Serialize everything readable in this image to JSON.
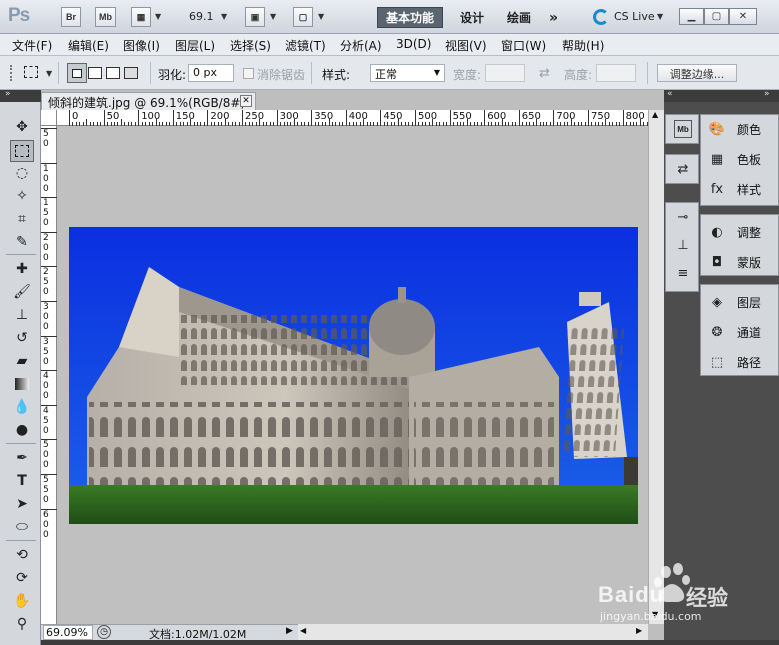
{
  "titlebar": {
    "logo": "Ps",
    "br_label": "Br",
    "mb_label": "Mb",
    "zoom_value": "69.1",
    "workspaces": [
      "基本功能",
      "设计",
      "绘画"
    ],
    "more": "»",
    "cs_live": "CS Live"
  },
  "menu": [
    "文件(F)",
    "编辑(E)",
    "图像(I)",
    "图层(L)",
    "选择(S)",
    "滤镜(T)",
    "分析(A)",
    "3D(D)",
    "视图(V)",
    "窗口(W)",
    "帮助(H)"
  ],
  "options": {
    "feather_label": "羽化:",
    "feather_value": "0 px",
    "antialias_label": "消除锯齿",
    "style_label": "样式:",
    "style_value": "正常",
    "width_label": "宽度:",
    "height_label": "高度:",
    "refine_edge": "调整边缘..."
  },
  "document": {
    "tab_title": "倾斜的建筑.jpg @ 69.1%(RGB/8#)",
    "zoom": "69.09%",
    "doc_info": "文档:1.02M/1.02M",
    "ruler_top": [
      "0",
      "50",
      "100",
      "150",
      "200",
      "250",
      "300",
      "350",
      "400",
      "450",
      "500",
      "550",
      "600",
      "650",
      "700",
      "750",
      "800"
    ],
    "ruler_left": [
      "5\n0",
      "1\n0\n0",
      "1\n5\n0",
      "2\n0\n0",
      "2\n5\n0",
      "3\n0\n0",
      "3\n5\n0",
      "4\n0\n0",
      "4\n5\n0",
      "5\n0\n0",
      "5\n5\n0",
      "6\n0\n0"
    ]
  },
  "panels": [
    {
      "icon": "color-palette-icon",
      "label": "颜色"
    },
    {
      "icon": "swatches-icon",
      "label": "色板"
    },
    {
      "icon": "styles-icon",
      "label": "样式"
    },
    {
      "icon": "adjustments-icon",
      "label": "调整"
    },
    {
      "icon": "masks-icon",
      "label": "蒙版"
    },
    {
      "icon": "layers-icon",
      "label": "图层"
    },
    {
      "icon": "channels-icon",
      "label": "通道"
    },
    {
      "icon": "paths-icon",
      "label": "路径"
    }
  ],
  "watermark": {
    "brand": "Baidu",
    "brand_cn": "经验",
    "url": "jingyan.baidu.com"
  },
  "colors": {
    "sky": "#0a2fd6",
    "grass": "#2f6a1f",
    "building": "#b9b2a8",
    "ui_accent": "#5b6570"
  }
}
